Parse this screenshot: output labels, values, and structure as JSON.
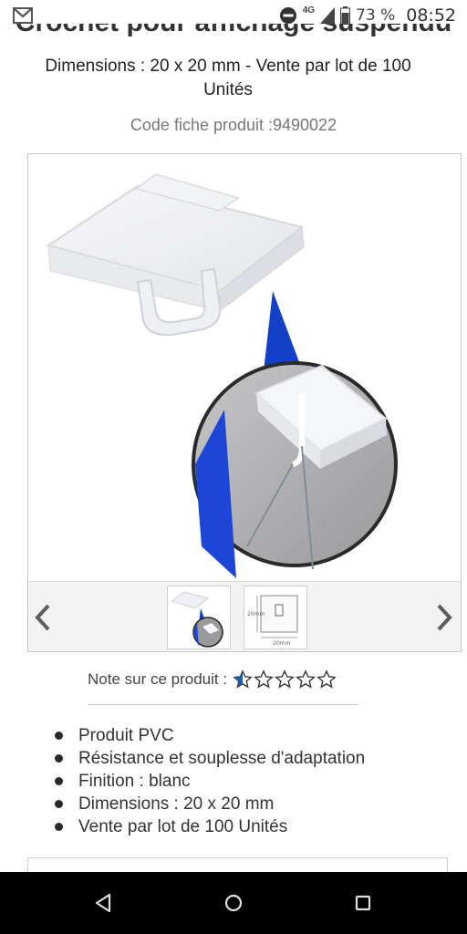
{
  "status_bar": {
    "notification_icon": "gmail-icon",
    "network_label": "4G",
    "battery_percent": "73 %",
    "time": "08:52"
  },
  "product": {
    "title_cut": "Crochet pour affichage suspendu",
    "subtitle": "Dimensions : 20 x 20 mm - Vente par lot de 100 Unités",
    "code_label": "Code fiche produit :",
    "code_value": "9490022"
  },
  "gallery": {
    "thumbnail_count": 2,
    "active_thumbnail": 1,
    "dimension_label_width": "20mm",
    "dimension_label_height": "20mm"
  },
  "rating": {
    "label": "Note sur ce produit :",
    "value": 0.5,
    "max": 5
  },
  "features": [
    "Produit PVC",
    "Résistance et souplesse d'adaptation",
    "Finition : blanc",
    "Dimensions : 20 x 20 mm",
    "Vente par lot de 100 Unités"
  ],
  "colors": {
    "star_active": "#1a5fa8",
    "nav_bar": "#000000"
  }
}
